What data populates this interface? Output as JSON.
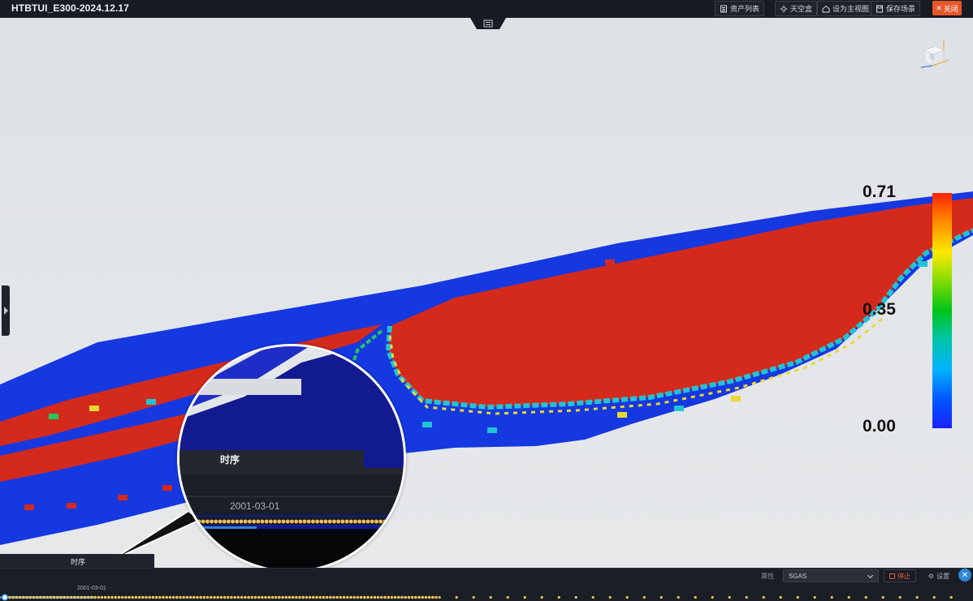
{
  "app": {
    "title": "HTBTUI_E300-2024.12.17"
  },
  "toolbar": {
    "asset_list": "资产列表",
    "skybox": "天空盒",
    "set_main_view": "设为主视图",
    "save_scene": "保存场景",
    "close": "关闭"
  },
  "viewcube": {
    "face_label": "左"
  },
  "color_scale": {
    "max_label": "0.71",
    "mid_label": "0.35",
    "min_label": "0.00",
    "colors": [
      "#ff2200",
      "#ffe800",
      "#00c419",
      "#00b3ff",
      "#1a22ff"
    ]
  },
  "magnifier": {
    "tab_label": "时序",
    "date": "2001-03-01"
  },
  "bottom_panel": {
    "tab_label": "时序",
    "property_label": "属性",
    "property_value": "SGAS",
    "stop_label": "停止",
    "settings_label": "设置",
    "current_date": "2001-03-01",
    "timeline_progress": 0.45
  },
  "colors": {
    "accent_blue": "#2f86d6",
    "close_orange": "#e8562a",
    "timeline_dot": "#f0c15a"
  }
}
